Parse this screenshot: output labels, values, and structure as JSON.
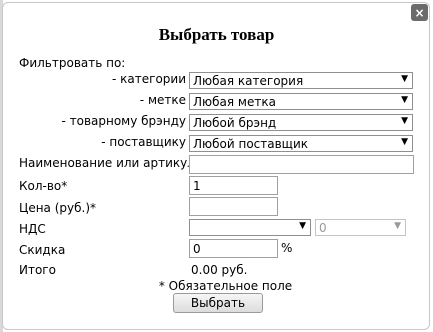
{
  "dialog": {
    "title": "Выбрать товар",
    "close_icon": "×",
    "filter_label": "Фильтровать по:",
    "filters": {
      "category": {
        "label": "- категории",
        "value": "Любая категория"
      },
      "tag": {
        "label": "- метке",
        "value": "Любая метка"
      },
      "brand": {
        "label": "- товарному брэнду",
        "value": "Любой брэнд"
      },
      "supplier": {
        "label": "- поставщику",
        "value": "Любой поставщик"
      }
    },
    "fields": {
      "name": {
        "label": "Наименование или артикул*",
        "value": ""
      },
      "quantity": {
        "label": "Кол-во*",
        "value": "1"
      },
      "price": {
        "label": "Цена (руб.)*",
        "value": ""
      },
      "vat": {
        "label": "НДС",
        "value": "",
        "rate_value": "0"
      },
      "discount": {
        "label": "Скидка",
        "value": "0",
        "unit": "%"
      },
      "total": {
        "label": "Итого",
        "value": "0.00 руб."
      }
    },
    "required_note": "* Обязательное поле",
    "submit_label": "Выбрать",
    "arrow_icon": "▼"
  }
}
